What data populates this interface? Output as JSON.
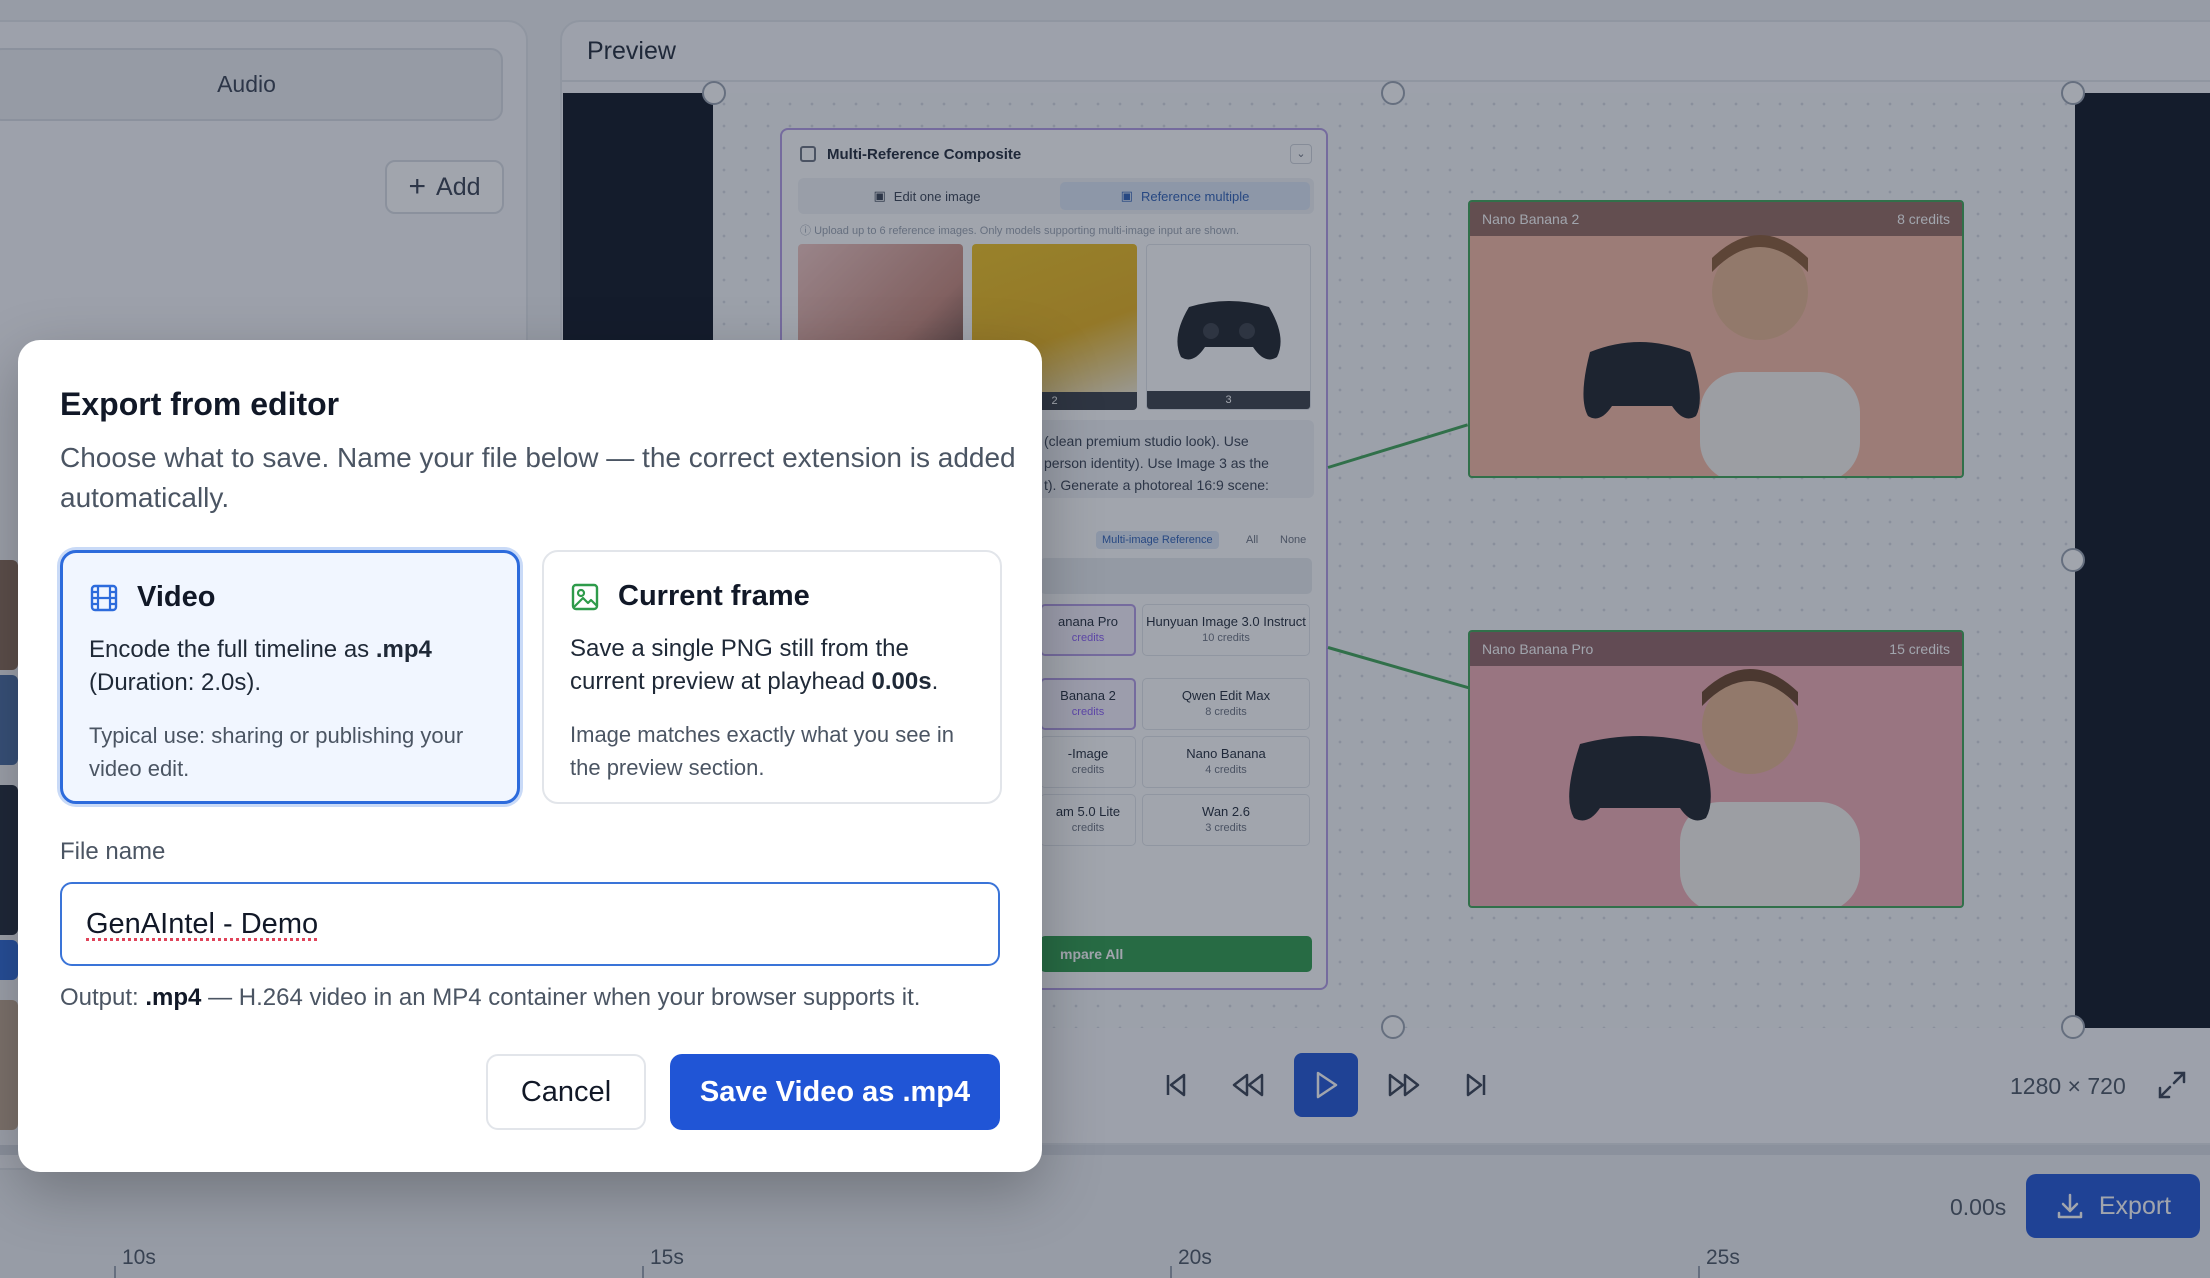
{
  "left_panel": {
    "audio_tab": "Audio",
    "add_label": "Add"
  },
  "preview": {
    "title": "Preview",
    "resolution": "1280 × 720",
    "node": {
      "title": "Multi-Reference Composite",
      "tab_edit_one": "Edit one image",
      "tab_reference_multiple": "Reference multiple",
      "hint": "Upload up to 6 reference images. Only models supporting multi-image input are shown.",
      "ref_numbers": [
        "2",
        "3"
      ],
      "prompt_lines": [
        "(clean premium studio look). Use",
        "person identity). Use Image 3 as the",
        "t). Generate a photoreal 16:9 scene:"
      ],
      "filter_multi": "Multi-image Reference",
      "filter_all": "All",
      "filter_none": "None",
      "models": [
        {
          "name": "anana Pro",
          "credits": "credits"
        },
        {
          "name": "Hunyuan Image 3.0 Instruct",
          "credits": "10 credits"
        },
        {
          "name": "Banana 2",
          "credits": "credits"
        },
        {
          "name": "Qwen Edit Max",
          "credits": "8 credits"
        },
        {
          "name": "-Image",
          "credits": "credits"
        },
        {
          "name": "Nano Banana",
          "credits": "4 credits"
        },
        {
          "name": "am 5.0 Lite",
          "credits": "credits"
        },
        {
          "name": "Wan 2.6",
          "credits": "3 credits"
        }
      ],
      "compare_label": "mpare All"
    },
    "results": [
      {
        "model": "Nano Banana 2",
        "credits": "8 credits"
      },
      {
        "model": "Nano Banana Pro",
        "credits": "15 credits"
      }
    ]
  },
  "timeline": {
    "time": "0.00s",
    "export_label": "Export",
    "ruler": [
      "10s",
      "15s",
      "20s",
      "25s"
    ]
  },
  "modal": {
    "title": "Export from editor",
    "description": "Choose what to save. Name your file below — the correct extension is added automatically.",
    "video": {
      "title": "Video",
      "body_prefix": "Encode the full timeline as ",
      "body_ext": ".mp4",
      "body_suffix": " (Duration: 2.0s).",
      "note": "Typical use: sharing or publishing your video edit."
    },
    "frame": {
      "title": "Current frame",
      "body_prefix": "Save a single PNG still from the current preview at playhead ",
      "body_time": "0.00s",
      "body_suffix": ".",
      "note": "Image matches exactly what you see in the preview section."
    },
    "file_label": "File name",
    "file_value": "GenAIntel - Demo",
    "output_prefix": "Output: ",
    "output_ext": ".mp4",
    "output_suffix": " — H.264 video in an MP4 container when your browser supports it.",
    "cancel_label": "Cancel",
    "save_label": "Save Video as .mp4"
  },
  "colors": {
    "accent": "#2055d6",
    "selected_border": "#2d6bdc",
    "connector_green": "#3fa455",
    "node_purple": "#b49be6"
  }
}
